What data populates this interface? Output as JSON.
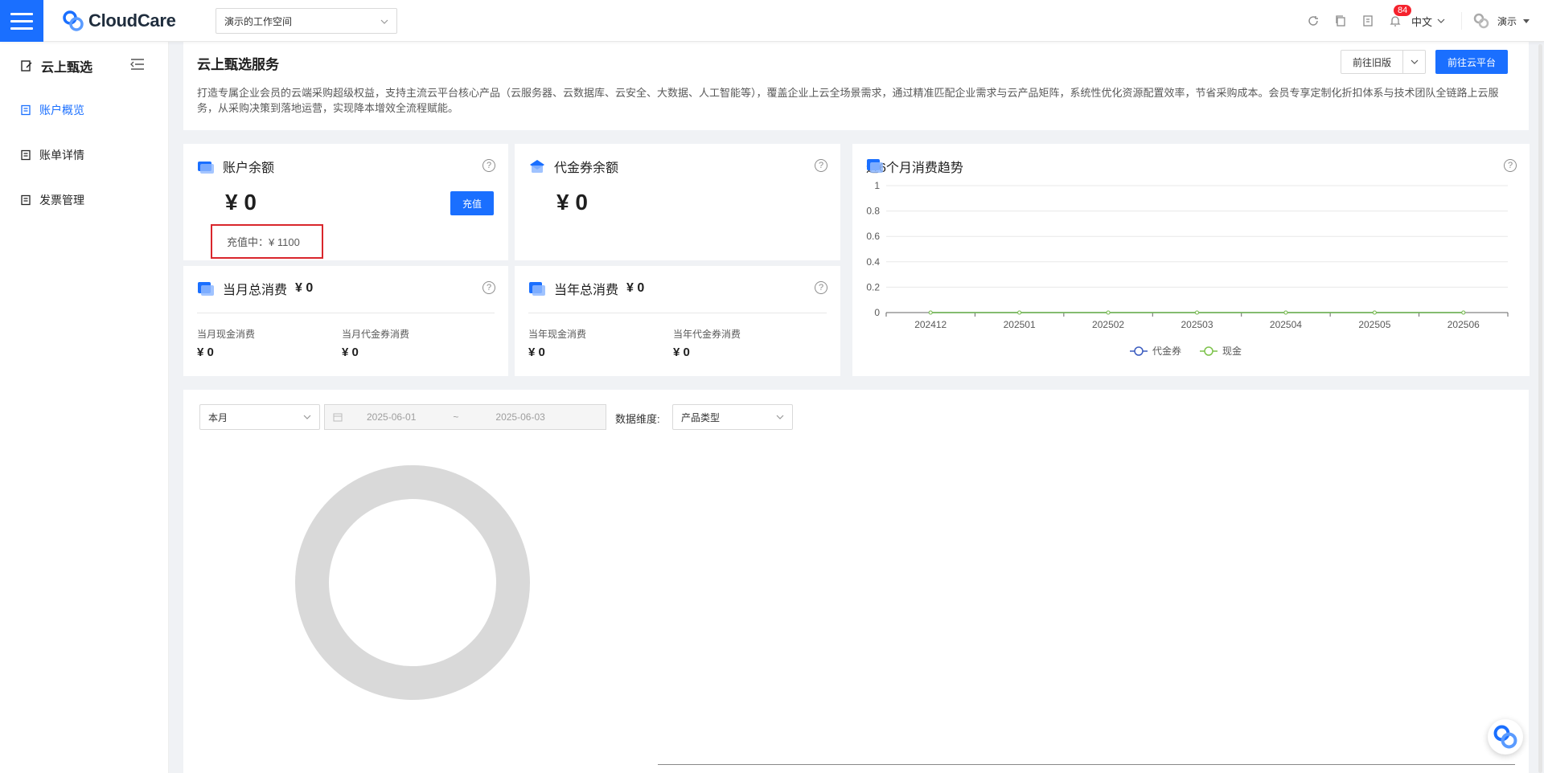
{
  "topbar": {
    "brand": "CloudCare",
    "workspace": "演示的工作空间",
    "notifications": "84",
    "language": "中文",
    "user": "演示"
  },
  "sidebar": {
    "title": "云上甄选",
    "items": [
      {
        "label": "账户概览",
        "active": true
      },
      {
        "label": "账单详情",
        "active": false
      },
      {
        "label": "发票管理",
        "active": false
      }
    ]
  },
  "intro": {
    "title": "云上甄选服务",
    "desc": "打造专属企业会员的云端采购超级权益，支持主流云平台核心产品（云服务器、云数据库、云安全、大数据、人工智能等），覆盖企业上云全场景需求，通过精准匹配企业需求与云产品矩阵，系统性优化资源配置效率，节省采购成本。会员专享定制化折扣体系与技术团队全链路上云服务，从采购决策到落地运营，实现降本增效全流程赋能。",
    "btn_old": "前往旧版",
    "btn_cloud": "前往云平台"
  },
  "balance": {
    "title": "账户余额",
    "amount": "¥ 0",
    "charge_btn": "充值",
    "charging": "充值中：¥ 1100"
  },
  "voucher": {
    "title": "代金券余额",
    "amount": "¥ 0"
  },
  "month": {
    "title": "当月总消费",
    "total": "¥ 0",
    "cash_label": "当月现金消费",
    "cash": "¥ 0",
    "voucher_label": "当月代金券消费",
    "voucher": "¥ 0"
  },
  "year": {
    "title": "当年总消费",
    "total": "¥ 0",
    "cash_label": "当年现金消费",
    "cash": "¥ 0",
    "voucher_label": "当年代金券消费",
    "voucher": "¥ 0"
  },
  "trend": {
    "title": "近6个月消费趋势"
  },
  "chart_data": {
    "type": "line",
    "x": [
      "202412",
      "202501",
      "202502",
      "202503",
      "202504",
      "202505",
      "202506"
    ],
    "yticks": [
      "0",
      "0.2",
      "0.4",
      "0.6",
      "0.8",
      "1"
    ],
    "ylim": [
      0,
      1
    ],
    "series": [
      {
        "name": "代金券",
        "values": [
          0,
          0,
          0,
          0,
          0,
          0,
          0
        ],
        "color": "#3a5bbf"
      },
      {
        "name": "现金",
        "values": [
          0,
          0,
          0,
          0,
          0,
          0,
          0
        ],
        "color": "#7cc24a"
      }
    ],
    "legend": "bottom-center"
  },
  "filters": {
    "period": "本月",
    "date_start": "2025-06-01",
    "date_sep": "~",
    "date_end": "2025-06-03",
    "dimension_label": "数据维度:",
    "dimension": "产品类型"
  },
  "colors": {
    "primary": "#1a6fff",
    "highlight_border": "#d9262c",
    "donut": "#d9d9d9"
  }
}
